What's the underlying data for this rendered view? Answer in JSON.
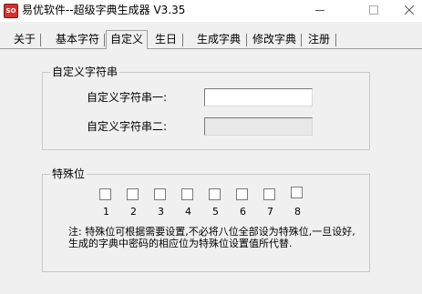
{
  "window": {
    "icon_text": "SO",
    "title": "易优软件--超级字典生成器 V3.35"
  },
  "tabs": [
    {
      "label": "关于"
    },
    {
      "label": "基本字符"
    },
    {
      "label": "自定义"
    },
    {
      "label": "生日"
    },
    {
      "label": "生成字典"
    },
    {
      "label": "修改字典"
    },
    {
      "label": "注册"
    }
  ],
  "custom_group": {
    "title": "自定义字符串",
    "field1_label": "自定义字符串一:",
    "field1_value": "",
    "field2_label": "自定义字符串二:",
    "field2_value": ""
  },
  "special_group": {
    "title": "特殊位",
    "positions": [
      "1",
      "2",
      "3",
      "4",
      "5",
      "6",
      "7",
      "8"
    ],
    "note": "注: 特殊位可根据需要设置,不必将八位全部设为特殊位,一旦设好,生成的字典中密码的相应位为特殊位设置值所代替."
  }
}
